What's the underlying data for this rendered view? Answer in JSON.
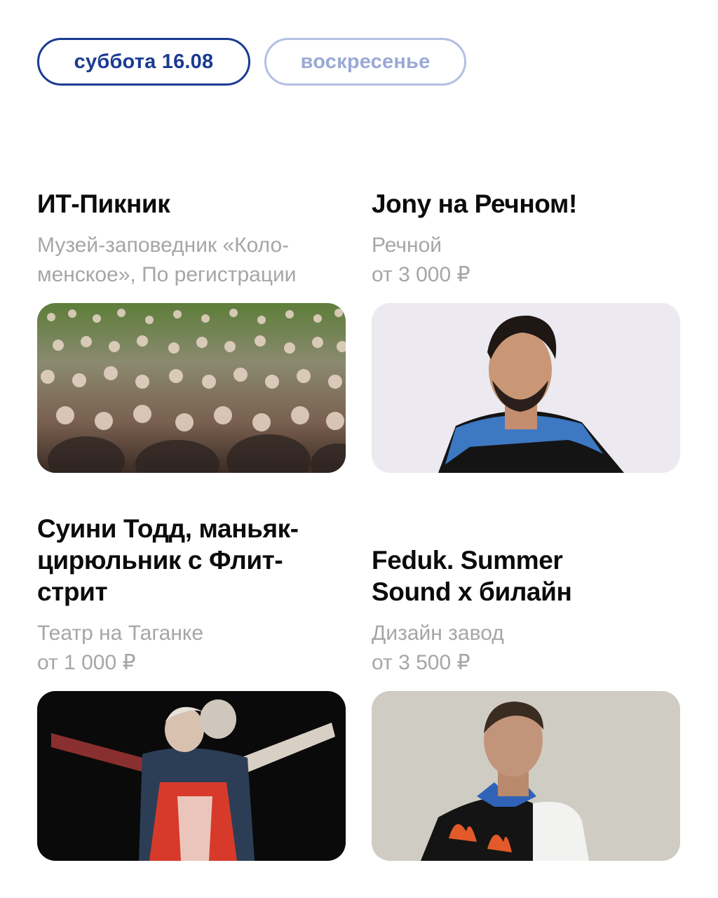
{
  "tabs": [
    {
      "label": "суббота 16.08",
      "active": true
    },
    {
      "label": "воскресенье",
      "active": false
    }
  ],
  "events": [
    {
      "title": "ИТ-Пикник",
      "venue_line1": "Музей-заповедник «Коло-",
      "venue_line2": "менское», По регистрации",
      "image_icon": "crowd-photo"
    },
    {
      "title": "Jony на Речном!",
      "venue_line1": "Речной",
      "venue_line2": "от 3 000 ₽",
      "image_icon": "artist-photo"
    },
    {
      "title_line1": "Суини Тодд, маньяк-",
      "title_line2": "цирюльник с Флит-",
      "title_line3": "стрит",
      "venue_line1": "Театр на Таганке",
      "venue_line2": "от 1 000 ₽",
      "image_icon": "theatre-photo"
    },
    {
      "title_line1": "Feduk. Summer",
      "title_line2": "Sound x билайн",
      "venue_line1": "Дизайн завод",
      "venue_line2": "от 3 500 ₽",
      "image_icon": "artist-photo"
    }
  ],
  "colors": {
    "accent": "#1a3b93",
    "accent_inactive": "#9aa9d6",
    "muted_text": "#a6a6a6"
  }
}
